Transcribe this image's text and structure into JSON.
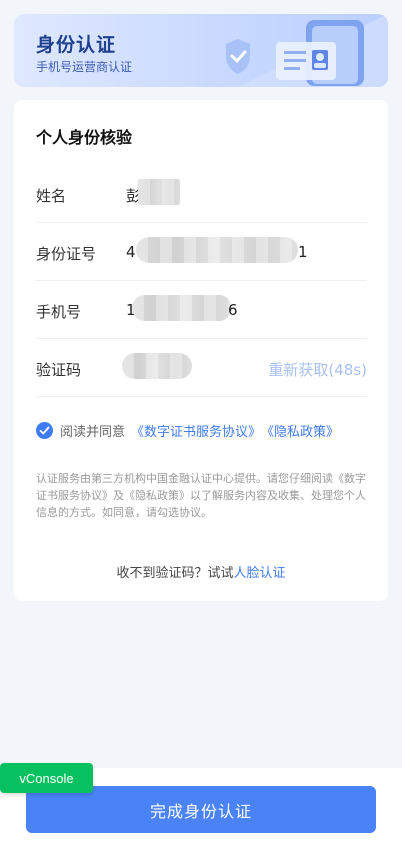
{
  "banner": {
    "title": "身份认证",
    "subtitle": "手机号运营商认证"
  },
  "card": {
    "title": "个人身份核验",
    "fields": [
      {
        "label": "姓名",
        "value_visible": "彭"
      },
      {
        "label": "身份证号",
        "value_prefix": "4",
        "value_suffix": "1"
      },
      {
        "label": "手机号",
        "value_prefix": "1",
        "value_suffix": "6"
      },
      {
        "label": "验证码",
        "resend": "重新获取(48s)"
      }
    ],
    "agreement": {
      "checked": true,
      "text": "阅读并同意",
      "link1": "《数字证书服务协议》",
      "link2": "《隐私政策》"
    },
    "notice": "认证服务由第三方机构中国金融认证中心提供。请您仔细阅读《数字证书服务协议》及《隐私政策》以了解服务内容及收集、处理您个人信息的方式。如同意，请勾选协议。",
    "alt_prompt": "收不到验证码？试试",
    "alt_link": "人脸认证"
  },
  "submit_label": "完成身份认证",
  "vconsole_label": "vConsole",
  "colors": {
    "accent": "#4a82f7",
    "link": "#3f7cf4",
    "resend_disabled": "#a9c1f2",
    "vconsole": "#07c160"
  }
}
